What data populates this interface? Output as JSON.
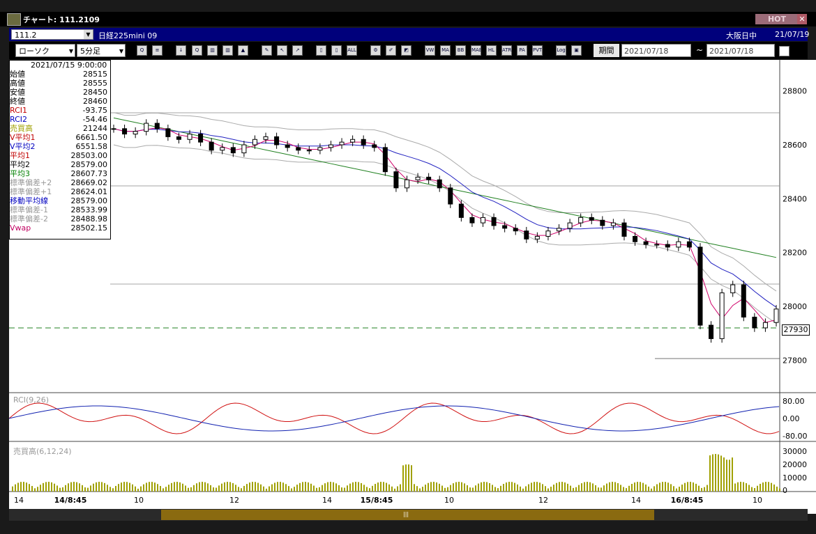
{
  "window": {
    "title": "チャート: 111.2109",
    "hot_label": "HOT",
    "close_label": "✕"
  },
  "info": {
    "code": "111.2",
    "name": "日経225mini 09",
    "market": "大阪日中",
    "date": "21/07/19"
  },
  "toolbar": {
    "chart_type": "ローソク",
    "interval": "5分足",
    "period_label": "期間",
    "date_from": "2021/07/18",
    "date_to": "2021/07/18",
    "tilde": "~",
    "buttons": [
      {
        "name": "zoom-icon",
        "label": "Q"
      },
      {
        "name": "columns-icon",
        "label": "≡"
      },
      {
        "name": "download-icon",
        "label": "↓"
      },
      {
        "name": "search-chart-icon",
        "label": "Q"
      },
      {
        "name": "bar-chart-icon",
        "label": "▥"
      },
      {
        "name": "candle-chart-icon",
        "label": "▥"
      },
      {
        "name": "disabled-icon",
        "label": "▲"
      },
      {
        "name": "pencil-icon",
        "label": "✎"
      },
      {
        "name": "cursor-icon",
        "label": "↖"
      },
      {
        "name": "trend-icon",
        "label": "↗"
      },
      {
        "name": "candle-red-icon",
        "label": "▯"
      },
      {
        "name": "candle-blue-icon",
        "label": "▯"
      },
      {
        "name": "all-icon",
        "label": "ALL"
      },
      {
        "name": "settings-icon",
        "label": "⚙"
      },
      {
        "name": "tools-icon",
        "label": "✐"
      },
      {
        "name": "color-icon",
        "label": "◩"
      },
      {
        "name": "vwap-icon",
        "label": "VW"
      },
      {
        "name": "ma-icon",
        "label": "MA"
      },
      {
        "name": "bb-icon",
        "label": "BB"
      },
      {
        "name": "mae-icon",
        "label": "MAE"
      },
      {
        "name": "hl-icon",
        "label": "HL"
      },
      {
        "name": "atr-icon",
        "label": "ATR"
      },
      {
        "name": "para-icon",
        "label": "PA"
      },
      {
        "name": "pvt-icon",
        "label": "PVT"
      },
      {
        "name": "log-icon",
        "label": "Log"
      },
      {
        "name": "window-icon",
        "label": "▣"
      }
    ]
  },
  "legend": {
    "datetime": "2021/07/15 9:00:00",
    "rows": [
      {
        "key": "始値",
        "value": "28515",
        "color": "#000000"
      },
      {
        "key": "高値",
        "value": "28555",
        "color": "#000000"
      },
      {
        "key": "安値",
        "value": "28450",
        "color": "#000000"
      },
      {
        "key": "終値",
        "value": "28460",
        "color": "#000000"
      },
      {
        "key": "RCI1",
        "value": "-93.75",
        "color": "#c00000"
      },
      {
        "key": "RCI2",
        "value": "-54.46",
        "color": "#0000c0"
      },
      {
        "key": "売買高",
        "value": "21244",
        "color": "#a0a000"
      },
      {
        "key": "V平均1",
        "value": "6661.50",
        "color": "#c00000"
      },
      {
        "key": "V平均2",
        "value": "6551.58",
        "color": "#0000c0"
      },
      {
        "key": "平均1",
        "value": "28503.00",
        "color": "#c00000"
      },
      {
        "key": "平均2",
        "value": "28579.00",
        "color": "#000000"
      },
      {
        "key": "平均3",
        "value": "28607.73",
        "color": "#008000"
      },
      {
        "key": "標準偏差+2",
        "value": "28669.02",
        "color": "#999999"
      },
      {
        "key": "標準偏差+1",
        "value": "28624.01",
        "color": "#999999"
      },
      {
        "key": "移動平均線",
        "value": "28579.00",
        "color": "#0000c0"
      },
      {
        "key": "標準偏差-1",
        "value": "28533.99",
        "color": "#999999"
      },
      {
        "key": "標準偏差-2",
        "value": "28488.98",
        "color": "#999999"
      },
      {
        "key": "Vwap",
        "value": "28502.15",
        "color": "#c00060"
      }
    ]
  },
  "price_axis": {
    "labels": [
      "28800",
      "28600",
      "28400",
      "28200",
      "28000",
      "27800"
    ],
    "values": [
      28800,
      28600,
      28400,
      28200,
      28000,
      27800
    ]
  },
  "current_price": "27930",
  "rci_panel": {
    "title": "RCI(9,26)",
    "labels": [
      "80.00",
      "0.00",
      "-80.00"
    ]
  },
  "volume_panel": {
    "title": "売買高(6,12,24)",
    "labels": [
      "30000",
      "20000",
      "10000",
      "0"
    ]
  },
  "time_axis": {
    "labels": [
      "14",
      "14/8:45",
      "10",
      "12",
      "14",
      "15/8:45",
      "10",
      "12",
      "14",
      "16/8:45",
      "10"
    ]
  },
  "colors": {
    "up": "#ffffff",
    "down": "#000000",
    "ma1": "#d0006a",
    "ma2": "#2020c0",
    "ma3": "#208020",
    "band": "#aaaaaa",
    "rci1": "#d01010",
    "rci2": "#1020b0",
    "vol": "#a0a000"
  },
  "chart_data": {
    "type": "candlestick",
    "ylim": [
      27700,
      28900
    ],
    "close_path": [
      28660,
      28640,
      28650,
      28680,
      28660,
      28630,
      28620,
      28640,
      28610,
      28580,
      28590,
      28570,
      28600,
      28620,
      28630,
      28600,
      28590,
      28580,
      28580,
      28590,
      28600,
      28610,
      28620,
      28600,
      28590,
      28500,
      28440,
      28470,
      28480,
      28470,
      28440,
      28380,
      28330,
      28310,
      28330,
      28300,
      28290,
      28280,
      28250,
      28260,
      28280,
      28290,
      28310,
      28330,
      28320,
      28300,
      28310,
      28260,
      28240,
      28230,
      28230,
      28220,
      28240,
      28220,
      27930,
      27880,
      28050,
      28080,
      27960,
      27920,
      27940,
      27990
    ]
  }
}
